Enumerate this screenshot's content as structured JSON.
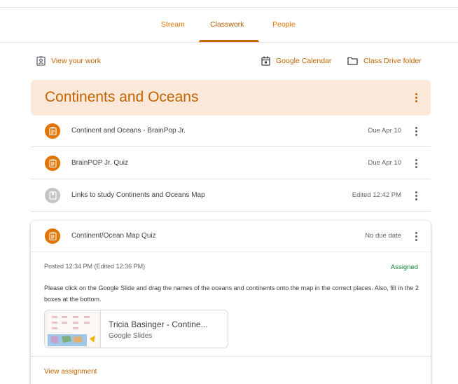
{
  "tabs": {
    "stream": "Stream",
    "classwork": "Classwork",
    "people": "People"
  },
  "actions": {
    "view_work": "View your work",
    "calendar": "Google Calendar",
    "drive": "Class Drive folder"
  },
  "topic": {
    "title": "Continents and Oceans"
  },
  "items": [
    {
      "title": "Continent and Oceans - BrainPop Jr.",
      "due": "Due Apr 10",
      "icon": "assignment-icon"
    },
    {
      "title": "BrainPOP Jr. Quiz",
      "due": "Due Apr 10",
      "icon": "assignment-icon"
    },
    {
      "title": "Links to study Continents and Oceans Map",
      "due": "Edited 12:42 PM",
      "icon": "material-icon"
    }
  ],
  "expanded": {
    "title": "Continent/Ocean Map Quiz",
    "due": "No due date",
    "posted": "Posted 12:34 PM (Edited 12:36 PM)",
    "status": "Assigned",
    "description": "Please click on the Google Slide and drag the names of the oceans and continents onto the map in the correct places. Also, fill in the 2 boxes at the bottom.",
    "attachment": {
      "title": "Tricia Basinger - Contine...",
      "type": "Google Slides"
    },
    "view_link": "View assignment"
  },
  "colors": {
    "accent": "#c26401",
    "topic_bg": "#fce8d8",
    "icon_orange": "#e37400",
    "assigned_green": "#188038"
  }
}
